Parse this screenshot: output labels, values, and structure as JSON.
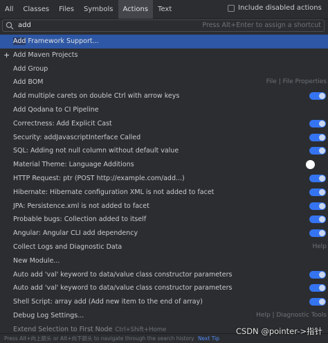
{
  "tabs": [
    {
      "label": "All"
    },
    {
      "label": "Classes"
    },
    {
      "label": "Files"
    },
    {
      "label": "Symbols"
    },
    {
      "label": "Actions",
      "active": true
    },
    {
      "label": "Text"
    }
  ],
  "include_disabled_label": "Include disabled actions",
  "search": {
    "query": "add",
    "hint": "Press Alt+Enter to assign a shortcut"
  },
  "items": [
    {
      "hl": "Add",
      "rest": " Framework Support...",
      "selected": true
    },
    {
      "text": "Add Maven Projects",
      "plus": true
    },
    {
      "text": "Add Group"
    },
    {
      "text": "Add BOM",
      "right": "File | File Properties"
    },
    {
      "text": "Add multiple carets on double Ctrl with arrow keys",
      "toggle": "on"
    },
    {
      "text": "Add Qodana to CI Pipeline"
    },
    {
      "text": "Correctness: Add Explicit Cast",
      "toggle": "on"
    },
    {
      "text": "Security: addJavascriptInterface Called",
      "toggle": "on"
    },
    {
      "text": "SQL: Adding not null column without default value",
      "toggle": "on"
    },
    {
      "text": "Material Theme: Language Additions",
      "toggle": "off"
    },
    {
      "text": "HTTP Request: ptr (POST http://example.com/add...)",
      "toggle": "on"
    },
    {
      "text": "Hibernate: Hibernate configuration XML is not added to facet",
      "toggle": "on"
    },
    {
      "text": "JPA: Persistence.xml is not added to facet",
      "toggle": "on"
    },
    {
      "text": "Probable bugs: Collection added to itself",
      "toggle": "on"
    },
    {
      "text": "Angular: Angular CLI add dependency",
      "toggle": "on"
    },
    {
      "text": "Collect Logs and Diagnostic Data",
      "right": "Help"
    },
    {
      "text": "New Module..."
    },
    {
      "text": "Auto add 'val' keyword to data/value class constructor parameters",
      "toggle": "on"
    },
    {
      "text": "Auto add 'val' keyword to data/value class constructor parameters",
      "toggle": "on"
    },
    {
      "text": "Shell Script: array add (Add new item to the end of array)",
      "toggle": "on"
    },
    {
      "text": "Debug Log Settings...",
      "right": "Help | Diagnostic Tools"
    },
    {
      "text": "Extend Selection to First Node",
      "shortcut": "Ctrl+Shift+Home",
      "cut": true
    }
  ],
  "footer": {
    "text": "Press Alt+向上箭头 or Alt+向下箭头 to navigate through the search history",
    "tip": "Next Tip"
  },
  "watermark": "CSDN @pointer->指针",
  "colors": {
    "background": "#2b2d30",
    "selection": "#2e57a5",
    "toggle_on": "#3574f0",
    "link": "#548af7"
  }
}
